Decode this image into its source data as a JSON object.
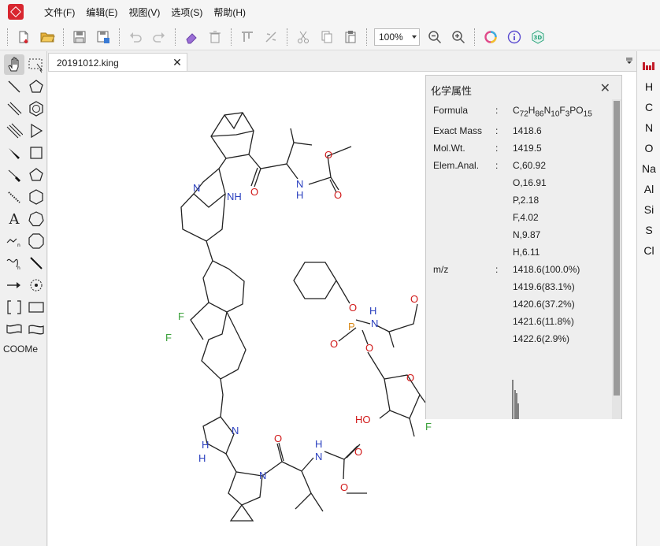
{
  "menu": {
    "items": [
      "文件(F)",
      "编辑(E)",
      "视图(V)",
      "选项(S)",
      "帮助(H)"
    ]
  },
  "toolbar": {
    "zoom_value": "100%",
    "icons": [
      "new-file-icon",
      "open-folder-icon",
      "save-icon",
      "save-as-icon",
      "undo-icon",
      "redo-icon",
      "eraser-icon",
      "delete-icon",
      "align-icon",
      "flip-icon",
      "cut-icon",
      "copy-icon",
      "paste-icon",
      "zoom-out-icon",
      "zoom-in-icon",
      "color-icon",
      "info-icon",
      "3d-icon"
    ]
  },
  "palette": {
    "text_tool": "A",
    "cooMe_tool": "COOMe"
  },
  "document": {
    "tab_label": "20191012.king"
  },
  "elements": [
    "H",
    "C",
    "N",
    "O",
    "Na",
    "Al",
    "Si",
    "S",
    "Cl"
  ],
  "properties": {
    "title": "化学属性",
    "formula_label": "Formula",
    "formula": {
      "C": "72",
      "H": "86",
      "N": "10",
      "F": "3",
      "P": "",
      "O": "15"
    },
    "exact_mass_label": "Exact Mass",
    "exact_mass": "1418.6",
    "mol_wt_label": "Mol.Wt.",
    "mol_wt": "1419.5",
    "elem_anal_label": "Elem.Anal.",
    "elem_anal": [
      "C,60.92",
      "O,16.91",
      "P,2.18",
      "F,4.02",
      "N,9.87",
      "H,6.11"
    ],
    "mz_label": "m/z",
    "mz": [
      "1418.6(100.0%)",
      "1419.6(83.1%)",
      "1420.6(37.2%)",
      "1421.6(11.8%)",
      "1422.6(2.9%)"
    ]
  },
  "structure_labels": {
    "N": "N",
    "NH": "NH",
    "HN": "HN",
    "H": "H",
    "O": "O",
    "F": "F",
    "P": "P",
    "HO": "HO"
  },
  "colors": {
    "nitrogen": "#2a3fbf",
    "oxygen": "#d11a1a",
    "fluorine": "#3aa13a",
    "phosphorus": "#d98a1a",
    "logo": "#d8262f"
  }
}
